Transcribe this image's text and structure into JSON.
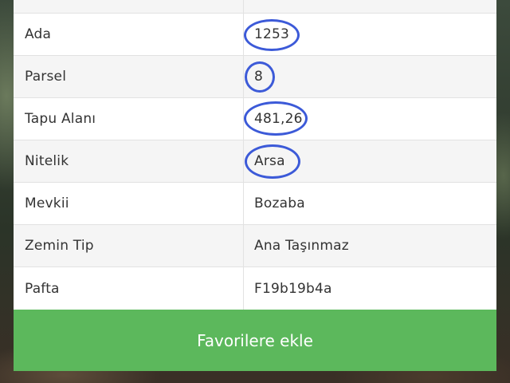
{
  "property_table": {
    "rows": [
      {
        "label": "",
        "value": ""
      },
      {
        "label": "Ada",
        "value": "1253"
      },
      {
        "label": "Parsel",
        "value": "8"
      },
      {
        "label": "Tapu Alanı",
        "value": "481,26"
      },
      {
        "label": "Nitelik",
        "value": "Arsa"
      },
      {
        "label": "Mevkii",
        "value": "Bozaba"
      },
      {
        "label": "Zemin Tip",
        "value": "Ana Taşınmaz"
      },
      {
        "label": "Pafta",
        "value": "F19b19b4a"
      }
    ],
    "circled_rows": [
      "Ada",
      "Parsel",
      "Tapu Alanı",
      "Nitelik"
    ]
  },
  "actions": {
    "favorite_label": "Favorilere ekle"
  },
  "colors": {
    "button": "#5cb85c",
    "annotation": "#3c5ad8"
  }
}
